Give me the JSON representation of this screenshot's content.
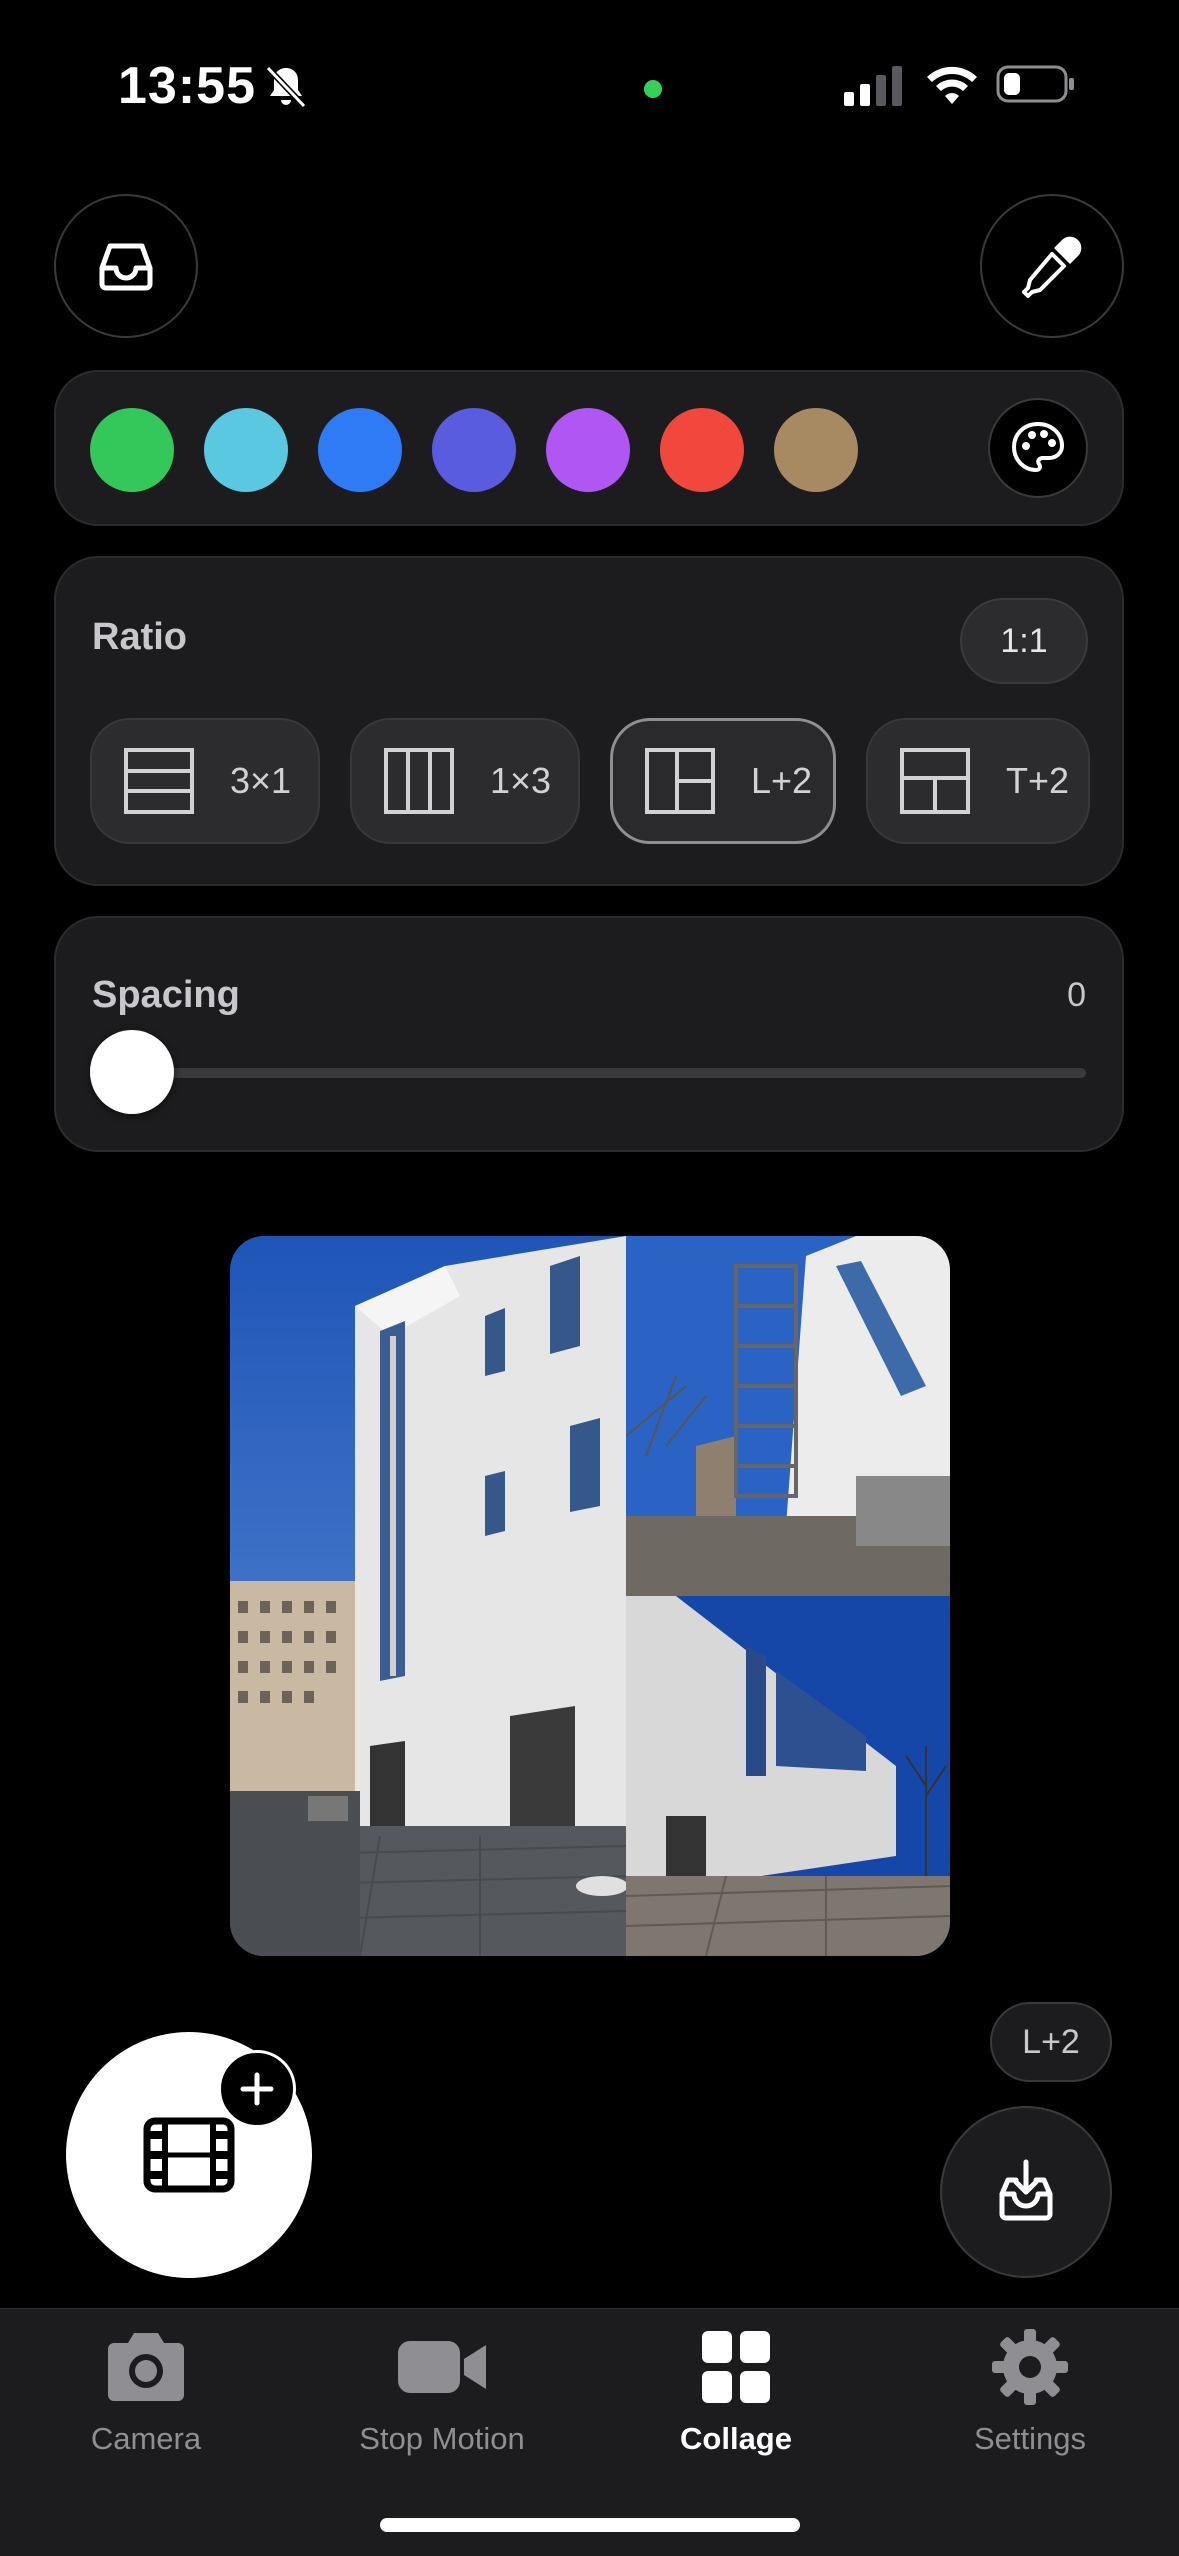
{
  "status_bar": {
    "time": "13:55",
    "icons": [
      "bell-slash-icon",
      "green-dot-indicator",
      "cellular-signal-icon",
      "wifi-icon",
      "battery-icon"
    ]
  },
  "top_buttons": {
    "left_icon": "tray-icon",
    "right_icon": "eyedropper-icon"
  },
  "colors": {
    "swatches": [
      "#34c759",
      "#5ac8e0",
      "#2f7bf6",
      "#5a5ce0",
      "#b056f2",
      "#f2473c",
      "#a88a62"
    ],
    "palette_icon": "palette-icon"
  },
  "ratio": {
    "title": "Ratio",
    "value": "1:1",
    "layouts": [
      {
        "label": "3×1",
        "icon": "three-rows-icon",
        "selected": false
      },
      {
        "label": "1×3",
        "icon": "three-columns-icon",
        "selected": false
      },
      {
        "label": "L+2",
        "icon": "left-plus-two-icon",
        "selected": true
      },
      {
        "label": "T+2",
        "icon": "top-plus-two-icon",
        "selected": false
      }
    ]
  },
  "spacing": {
    "title": "Spacing",
    "value": "0",
    "fraction": 0.0
  },
  "floating": {
    "add_video_icon": "film-icon",
    "plus_icon": "plus-icon",
    "layout_label": "L+2",
    "export_icon": "tray-arrow-down-icon"
  },
  "tabbar": {
    "tabs": [
      {
        "label": "Camera",
        "icon": "camera-icon",
        "active": false
      },
      {
        "label": "Stop Motion",
        "icon": "video-icon",
        "active": false
      },
      {
        "label": "Collage",
        "icon": "grid-icon",
        "active": true
      },
      {
        "label": "Settings",
        "icon": "gear-icon",
        "active": false
      }
    ]
  }
}
